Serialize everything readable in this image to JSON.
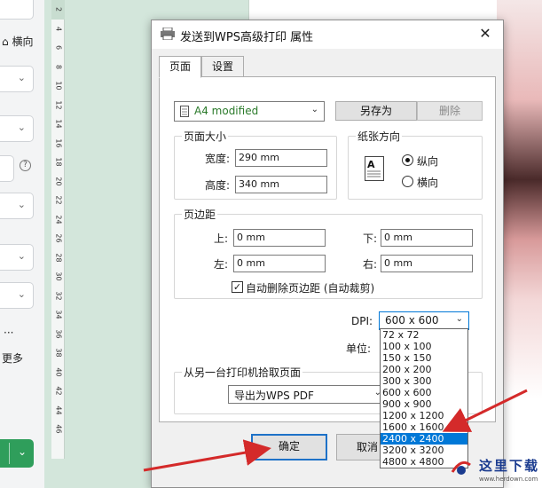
{
  "sidebar": {
    "orientation_label": "横向",
    "more_label": "更多",
    "ellipsis": "···"
  },
  "ruler": {
    "ticks": [
      "2",
      "4",
      "6",
      "8",
      "10",
      "12",
      "14",
      "16",
      "18",
      "20",
      "22",
      "24",
      "26",
      "28",
      "30",
      "32",
      "34",
      "36",
      "38",
      "40",
      "42",
      "44",
      "46"
    ]
  },
  "dialog": {
    "title": "发送到WPS高级打印 属性",
    "tabs": [
      {
        "label": "页面"
      },
      {
        "label": "设置"
      }
    ],
    "paper_preset": "A4 modified",
    "save_as_label": "另存为",
    "delete_label": "删除",
    "paper_size": {
      "title": "页面大小",
      "width_label": "宽度:",
      "width_value": "290 mm",
      "height_label": "高度:",
      "height_value": "340 mm"
    },
    "orientation": {
      "title": "纸张方向",
      "portrait_label": "纵向",
      "landscape_label": "横向",
      "selected": "portrait"
    },
    "margins": {
      "title": "页边距",
      "top_label": "上:",
      "top_value": "0 mm",
      "bottom_label": "下:",
      "bottom_value": "0 mm",
      "left_label": "左:",
      "left_value": "0 mm",
      "right_label": "右:",
      "right_value": "0 mm",
      "auto_crop_label": "自动删除页边距 (自动裁剪)",
      "auto_crop_checked": true
    },
    "dpi_label": "DPI:",
    "dpi_value": "600 x 600",
    "unit_label": "单位:",
    "pickup": {
      "title": "从另一台打印机拾取页面",
      "printer_value": "导出为WPS PDF"
    },
    "ok_label": "确定",
    "cancel_label": "取消",
    "dpi_options": [
      "72 x 72",
      "100 x 100",
      "150 x 150",
      "200 x 200",
      "300 x 300",
      "600 x 600",
      "900 x 900",
      "1200 x 1200",
      "1600 x 1600",
      "2400 x 2400",
      "3200 x 3200",
      "4800 x 4800"
    ],
    "dpi_highlighted": "2400 x 2400"
  },
  "watermark": {
    "text": "这里下载",
    "url": "www.herdown.com"
  },
  "colors": {
    "accent_blue": "#0078d7",
    "arrow_red": "#d42a2a",
    "sidebar_green": "#2f9e5b"
  }
}
